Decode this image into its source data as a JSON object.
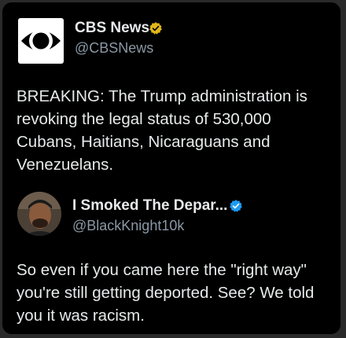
{
  "tweet": {
    "author_name": "CBS News",
    "author_handle": "@CBSNews",
    "verified_badge": "gold-check-badge",
    "text_lines": [
      "BREAKING: The Trump administration is",
      "revoking the legal status of 530,000",
      "Cubans, Haitians, Nicaraguans and",
      "Venezuelans."
    ]
  },
  "reply": {
    "author_name": "I Smoked The Depar...",
    "author_handle": "@BlackKnight10k",
    "verified_badge": "blue-check-badge",
    "text_lines": [
      "So even if you came here the \"right way\"",
      "you're still getting deported. See? We told",
      "you it was racism."
    ]
  },
  "colors": {
    "background": "#000000",
    "text": "#e7e9ea",
    "handle": "#8b98a5",
    "gold_badge": "#e2b719",
    "blue_badge": "#1d9bf0"
  }
}
